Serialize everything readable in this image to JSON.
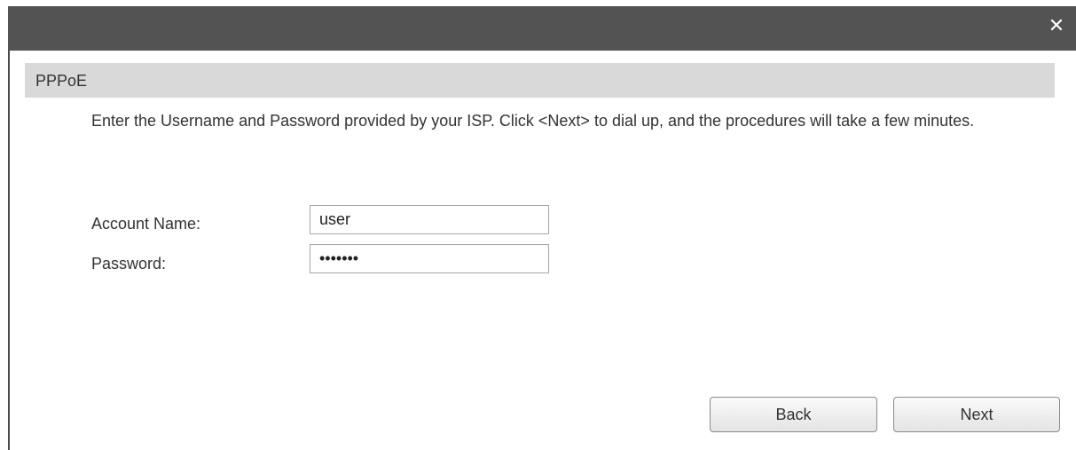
{
  "dialog": {
    "close_symbol": "✕"
  },
  "section": {
    "title": "PPPoE"
  },
  "description": "Enter the Username and Password provided by your ISP. Click <Next> to dial up, and the procedures will take a few minutes.",
  "form": {
    "account_name_label": "Account Name:",
    "account_name_value": "user",
    "password_label": "Password:",
    "password_value": "•••••••"
  },
  "buttons": {
    "back_label": "Back",
    "next_label": "Next"
  }
}
